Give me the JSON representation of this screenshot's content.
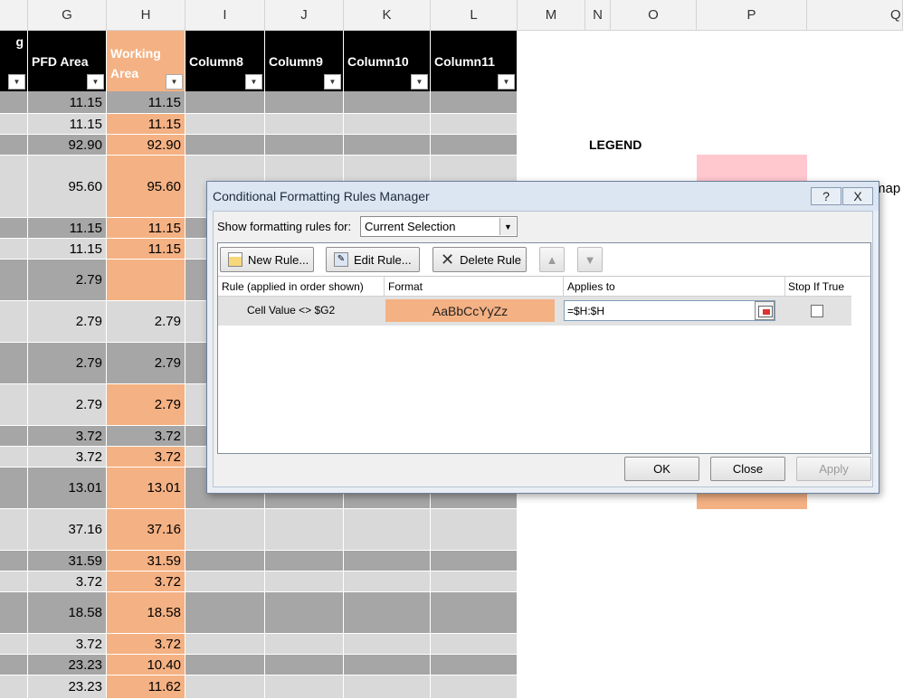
{
  "column_headers": [
    "G",
    "H",
    "I",
    "J",
    "K",
    "M",
    "N",
    "O",
    "P",
    "Q",
    "L"
  ],
  "table_headers": {
    "g_partial": "g",
    "pfd_area": "PFD Area",
    "working_area": "Working Area",
    "col8": "Column8",
    "col9": "Column9",
    "col10": "Column10",
    "col11": "Column11"
  },
  "rows": [
    {
      "g": "11.15",
      "h": "11.15",
      "shade": "dk",
      "hshade": "dk"
    },
    {
      "g": "11.15",
      "h": "11.15",
      "shade": "lt",
      "hshade": "org"
    },
    {
      "g": "92.90",
      "h": "92.90",
      "shade": "dk",
      "hshade": "org"
    },
    {
      "g": "95.60",
      "h": "95.60",
      "shade": "lt",
      "hshade": "org"
    },
    {
      "g": "11.15",
      "h": "11.15",
      "shade": "dk",
      "hshade": "org"
    },
    {
      "g": "11.15",
      "h": "11.15",
      "shade": "lt",
      "hshade": "org"
    },
    {
      "g": "2.79",
      "h": "",
      "shade": "dk",
      "hshade": "org"
    },
    {
      "g": "2.79",
      "h": "2.79",
      "shade": "lt",
      "hshade": "lt"
    },
    {
      "g": "2.79",
      "h": "2.79",
      "shade": "dk",
      "hshade": "dk"
    },
    {
      "g": "2.79",
      "h": "2.79",
      "shade": "lt",
      "hshade": "org"
    },
    {
      "g": "3.72",
      "h": "3.72",
      "shade": "dk",
      "hshade": "dk"
    },
    {
      "g": "3.72",
      "h": "3.72",
      "shade": "lt",
      "hshade": "org"
    },
    {
      "g": "13.01",
      "h": "13.01",
      "shade": "dk",
      "hshade": "org"
    },
    {
      "g": "37.16",
      "h": "37.16",
      "shade": "lt",
      "hshade": "org"
    },
    {
      "g": "31.59",
      "h": "31.59",
      "shade": "dk",
      "hshade": "org"
    },
    {
      "g": "3.72",
      "h": "3.72",
      "shade": "lt",
      "hshade": "org"
    },
    {
      "g": "18.58",
      "h": "18.58",
      "shade": "dk",
      "hshade": "org"
    },
    {
      "g": "3.72",
      "h": "3.72",
      "shade": "lt",
      "hshade": "org"
    },
    {
      "g": "23.23",
      "h": "10.40",
      "shade": "dk",
      "hshade": "org"
    },
    {
      "g": "23.23",
      "h": "11.62",
      "shade": "lt",
      "hshade": "org"
    }
  ],
  "legend": {
    "title": "LEGEND",
    "partial_text": "map"
  },
  "dialog": {
    "title": "Conditional Formatting Rules Manager",
    "help": "?",
    "close": "X",
    "show_label": "Show formatting rules for:",
    "show_value": "Current Selection",
    "new_rule": "New Rule...",
    "edit_rule": "Edit Rule...",
    "delete_rule": "Delete Rule",
    "col_rule": "Rule (applied in order shown)",
    "col_format": "Format",
    "col_applies": "Applies to",
    "col_stop": "Stop If True",
    "rule1_text": "Cell Value <> $G2",
    "rule1_preview": "AaBbCcYyZz",
    "rule1_applies": "=$H:$H",
    "ok": "OK",
    "close_btn": "Close",
    "apply": "Apply"
  },
  "colors": {
    "orange": "#f4b183",
    "pink": "#ffc7ce",
    "header_black": "#000000"
  }
}
